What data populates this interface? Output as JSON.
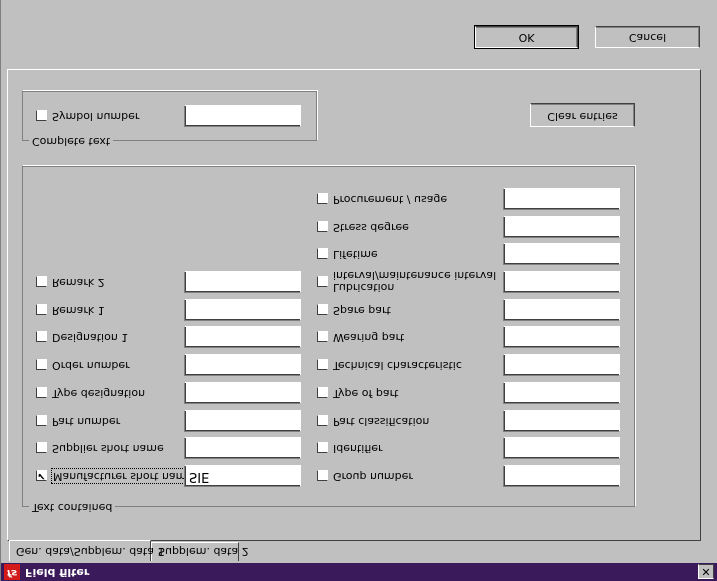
{
  "window": {
    "title": "Field filter",
    "icon": "app-icon",
    "icon_text": "fs",
    "close_label": "✕"
  },
  "tabs": [
    {
      "label": "Gen. data/Supplem. data 1"
    },
    {
      "label": "Supplem. data 2"
    }
  ],
  "text_contained": {
    "label": "Text contained",
    "left": [
      {
        "label": "Manufacturer short name",
        "checked": true,
        "value": "SIE"
      },
      {
        "label": "Supplier short name",
        "checked": false,
        "value": ""
      },
      {
        "label": "Part number",
        "checked": false,
        "value": ""
      },
      {
        "label": "Type designation",
        "checked": false,
        "value": ""
      },
      {
        "label": "Order number",
        "checked": false,
        "value": ""
      },
      {
        "label": "Designation 1",
        "checked": false,
        "value": ""
      },
      {
        "label": "Remark 1",
        "checked": false,
        "value": ""
      },
      {
        "label": "Remark 2",
        "checked": false,
        "value": ""
      }
    ],
    "right": [
      {
        "label": "Group number",
        "checked": false,
        "value": ""
      },
      {
        "label": "Identifier",
        "checked": false,
        "value": ""
      },
      {
        "label": "Part classification",
        "checked": false,
        "value": ""
      },
      {
        "label": "Type of part",
        "checked": false,
        "value": ""
      },
      {
        "label": "Technical characteristic",
        "checked": false,
        "value": ""
      },
      {
        "label": "Wearing part",
        "checked": false,
        "value": ""
      },
      {
        "label": "Spare part",
        "checked": false,
        "value": ""
      },
      {
        "label_line1": "Lubrication",
        "label_line2": "interval/maintenance interval",
        "checked": false,
        "value": ""
      },
      {
        "label": "Lifetime",
        "checked": false,
        "value": ""
      },
      {
        "label": "Stress degree",
        "checked": false,
        "value": ""
      },
      {
        "label": "Procurement / usage",
        "checked": false,
        "value": ""
      }
    ]
  },
  "complete_text": {
    "label": "Complete text",
    "item": {
      "label": "Symbol number",
      "checked": false,
      "value": ""
    }
  },
  "buttons": {
    "clear_entries": "Clear entries",
    "ok": "OK",
    "cancel": "Cancel"
  },
  "check_mark": "✔"
}
